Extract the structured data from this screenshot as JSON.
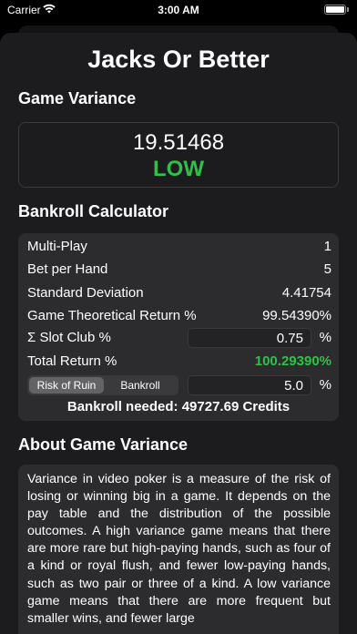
{
  "status_bar": {
    "carrier": "Carrier",
    "time": "3:00 AM"
  },
  "page": {
    "title": "Jacks Or Better"
  },
  "game_variance": {
    "heading": "Game Variance",
    "value": "19.51468",
    "level": "LOW",
    "level_color": "#30c04a"
  },
  "bankroll_calculator": {
    "heading": "Bankroll Calculator",
    "rows": [
      {
        "label": "Multi-Play",
        "value": "1"
      },
      {
        "label": "Bet per Hand",
        "value": "5"
      },
      {
        "label": "Standard Deviation",
        "value": "4.41754"
      },
      {
        "label": "Game Theoretical Return %",
        "value": "99.54390%"
      }
    ],
    "slot_club": {
      "label": "Σ Slot Club %",
      "value": "0.75",
      "unit": "%"
    },
    "total_return": {
      "label": "Total Return %",
      "value": "100.29390%"
    },
    "segment": {
      "options": [
        "Risk of Ruin",
        "Bankroll"
      ],
      "selected": "Risk of Ruin"
    },
    "risk_value": {
      "value": "5.0",
      "unit": "%"
    },
    "bankroll_needed": "Bankroll needed: 49727.69 Credits"
  },
  "about": {
    "heading": "About Game Variance",
    "text": "Variance in video poker is a measure of the risk of losing or winning big in a game. It depends on the pay table and the distribution of the possible outcomes. A high variance game means that there are more rare but high-paying hands, such as four of a kind or royal flush, and fewer low-paying hands, such as two pair or three of a kind. A low variance game means that there are more frequent but smaller wins, and fewer large"
  }
}
